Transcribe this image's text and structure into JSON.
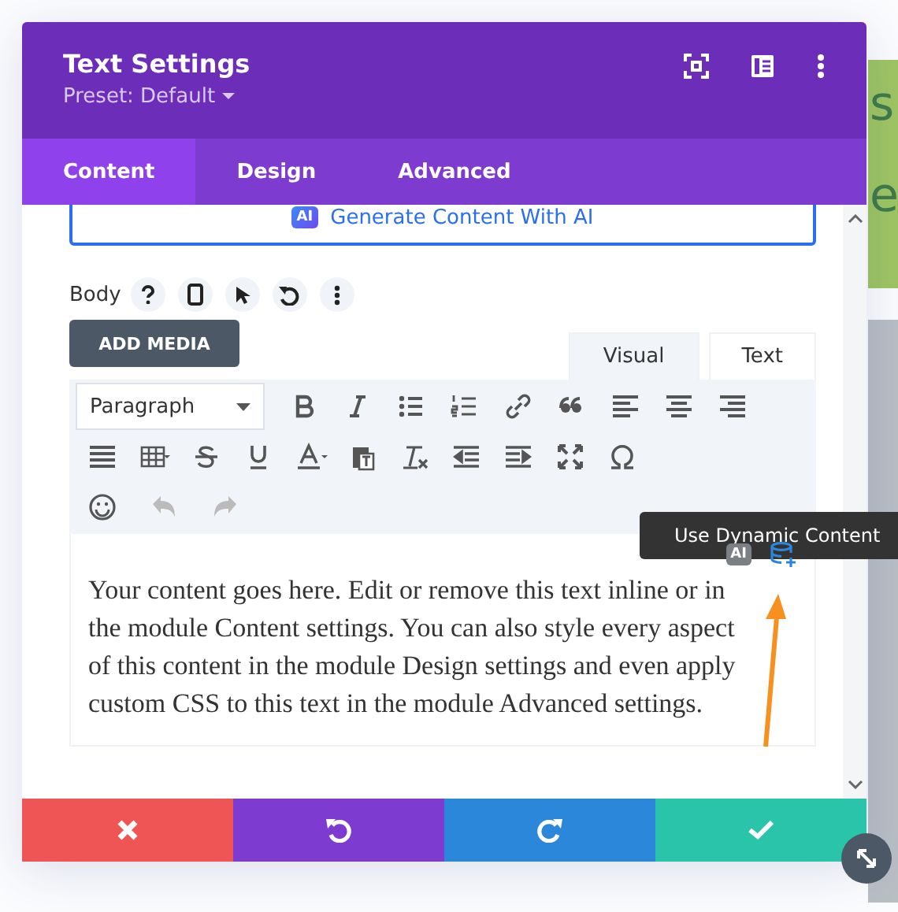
{
  "background_page": {
    "texts": [
      "s",
      "e"
    ]
  },
  "window": {
    "title": "Text Settings",
    "preset": "Preset: Default"
  },
  "tabs": [
    {
      "label": "Content",
      "selected": true
    },
    {
      "label": "Design",
      "selected": false
    },
    {
      "label": "Advanced",
      "selected": false
    }
  ],
  "generate_button": {
    "badge": "AI",
    "label": "Generate Content With AI"
  },
  "body_field": {
    "label": "Body",
    "add_media": "ADD MEDIA"
  },
  "editor_tabs": [
    {
      "label": "Visual",
      "selected": true
    },
    {
      "label": "Text",
      "selected": false
    }
  ],
  "toolbar": {
    "format": "Paragraph",
    "undo_disabled": true,
    "redo_disabled": true
  },
  "content": {
    "text": "Your content goes here. Edit or remove this text inline or in the module Content settings. You can also style every aspect of this content in the module Design settings and even apply custom CSS to this text in the module Advanced settings.",
    "ai_badge": "AI"
  },
  "tooltip": "Use Dynamic Content"
}
